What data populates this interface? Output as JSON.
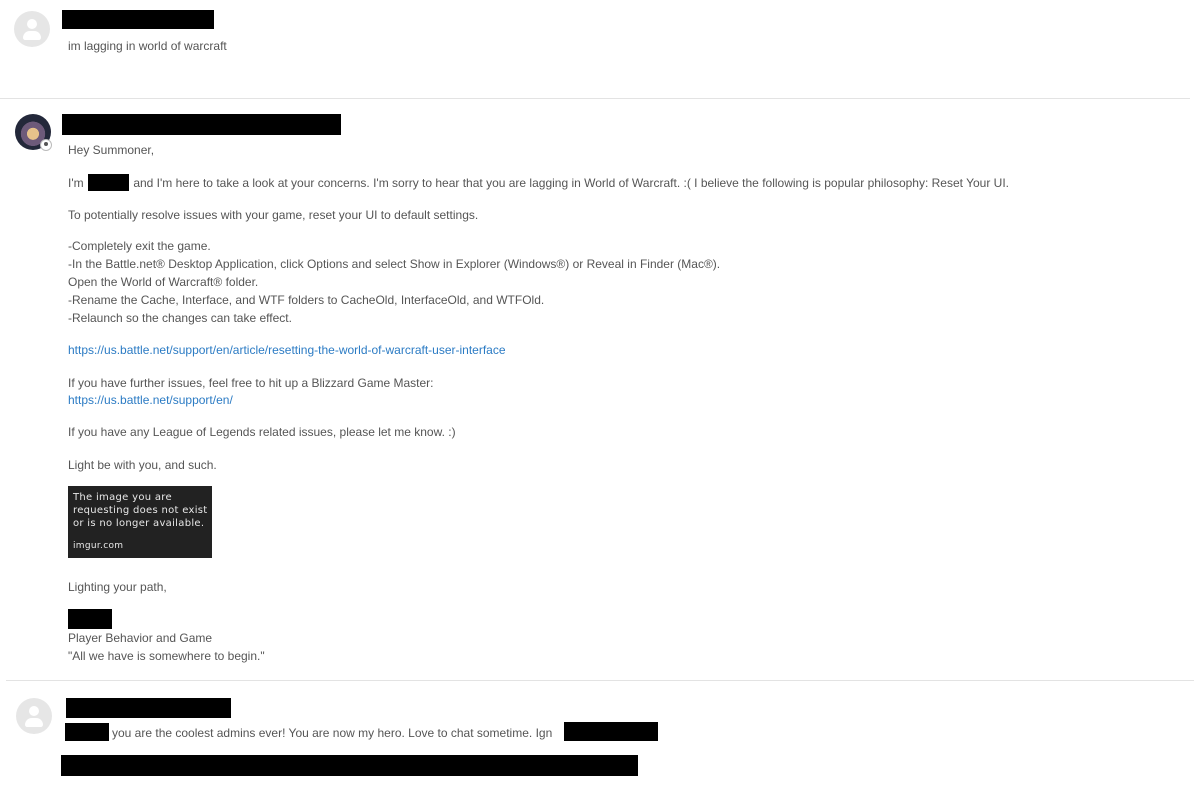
{
  "post1": {
    "message": "im lagging in world of warcraft"
  },
  "post2": {
    "greeting": "Hey Summoner,",
    "intro_pre": "I'm",
    "intro_post": "and I'm here to take a look at your concerns. I'm sorry to hear that you are lagging in World of Warcraft. :( I believe the following is popular philosophy: Reset Your UI.",
    "para_resolve": "To potentially resolve issues with your game, reset your UI to default settings.",
    "steps": [
      "-Completely exit the game.",
      "-In the Battle.net® Desktop Application, click Options and select Show in Explorer (Windows®) or Reveal in Finder (Mac®).",
      "Open the World of Warcraft® folder.",
      "-Rename the Cache, Interface, and WTF folders to CacheOld, InterfaceOld, and WTFOld.",
      "-Relaunch so the changes can take effect."
    ],
    "link_reset": "https://us.battle.net/support/en/article/resetting-the-world-of-warcraft-user-interface",
    "further_text": "If you have further issues, feel free to hit up a Blizzard Game Master:",
    "link_support": "https://us.battle.net/support/en/",
    "league_text": "If you have any League of Legends related issues, please let me know. :)",
    "light_text": "Light be with you, and such.",
    "image_placeholder": {
      "message": "The image you are\nrequesting does not exist\nor is no longer available.",
      "source": "imgur.com"
    },
    "signoff": "Lighting your path,",
    "team": "Player Behavior and Game",
    "quote": "\"All we have is somewhere to begin.\""
  },
  "post3": {
    "message": "you are the coolest admins ever! You are now my hero. Love to chat sometime. Ign"
  },
  "colors": {
    "link": "#2b7bc4",
    "text": "#555555",
    "redaction": "#000000",
    "divider": "#e3e3e3"
  }
}
